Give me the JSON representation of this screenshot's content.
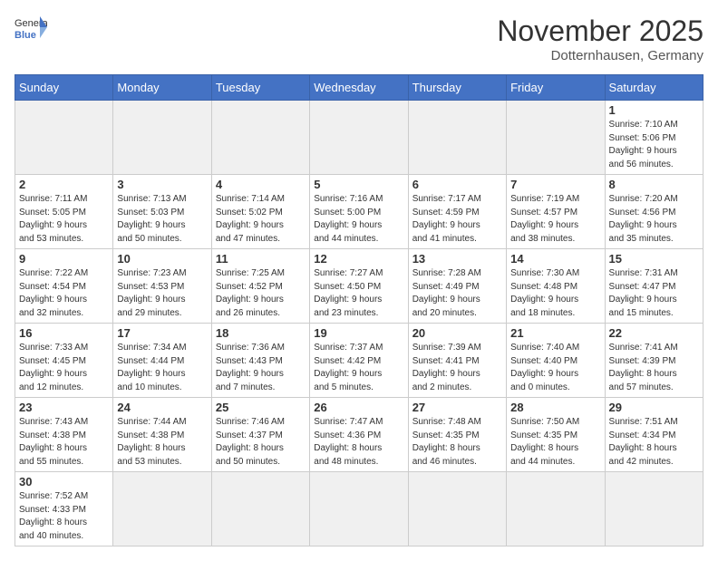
{
  "logo": {
    "text_general": "General",
    "text_blue": "Blue"
  },
  "title": "November 2025",
  "location": "Dotternhausen, Germany",
  "days_of_week": [
    "Sunday",
    "Monday",
    "Tuesday",
    "Wednesday",
    "Thursday",
    "Friday",
    "Saturday"
  ],
  "weeks": [
    [
      {
        "day": "",
        "info": ""
      },
      {
        "day": "",
        "info": ""
      },
      {
        "day": "",
        "info": ""
      },
      {
        "day": "",
        "info": ""
      },
      {
        "day": "",
        "info": ""
      },
      {
        "day": "",
        "info": ""
      },
      {
        "day": "1",
        "info": "Sunrise: 7:10 AM\nSunset: 5:06 PM\nDaylight: 9 hours\nand 56 minutes."
      }
    ],
    [
      {
        "day": "2",
        "info": "Sunrise: 7:11 AM\nSunset: 5:05 PM\nDaylight: 9 hours\nand 53 minutes."
      },
      {
        "day": "3",
        "info": "Sunrise: 7:13 AM\nSunset: 5:03 PM\nDaylight: 9 hours\nand 50 minutes."
      },
      {
        "day": "4",
        "info": "Sunrise: 7:14 AM\nSunset: 5:02 PM\nDaylight: 9 hours\nand 47 minutes."
      },
      {
        "day": "5",
        "info": "Sunrise: 7:16 AM\nSunset: 5:00 PM\nDaylight: 9 hours\nand 44 minutes."
      },
      {
        "day": "6",
        "info": "Sunrise: 7:17 AM\nSunset: 4:59 PM\nDaylight: 9 hours\nand 41 minutes."
      },
      {
        "day": "7",
        "info": "Sunrise: 7:19 AM\nSunset: 4:57 PM\nDaylight: 9 hours\nand 38 minutes."
      },
      {
        "day": "8",
        "info": "Sunrise: 7:20 AM\nSunset: 4:56 PM\nDaylight: 9 hours\nand 35 minutes."
      }
    ],
    [
      {
        "day": "9",
        "info": "Sunrise: 7:22 AM\nSunset: 4:54 PM\nDaylight: 9 hours\nand 32 minutes."
      },
      {
        "day": "10",
        "info": "Sunrise: 7:23 AM\nSunset: 4:53 PM\nDaylight: 9 hours\nand 29 minutes."
      },
      {
        "day": "11",
        "info": "Sunrise: 7:25 AM\nSunset: 4:52 PM\nDaylight: 9 hours\nand 26 minutes."
      },
      {
        "day": "12",
        "info": "Sunrise: 7:27 AM\nSunset: 4:50 PM\nDaylight: 9 hours\nand 23 minutes."
      },
      {
        "day": "13",
        "info": "Sunrise: 7:28 AM\nSunset: 4:49 PM\nDaylight: 9 hours\nand 20 minutes."
      },
      {
        "day": "14",
        "info": "Sunrise: 7:30 AM\nSunset: 4:48 PM\nDaylight: 9 hours\nand 18 minutes."
      },
      {
        "day": "15",
        "info": "Sunrise: 7:31 AM\nSunset: 4:47 PM\nDaylight: 9 hours\nand 15 minutes."
      }
    ],
    [
      {
        "day": "16",
        "info": "Sunrise: 7:33 AM\nSunset: 4:45 PM\nDaylight: 9 hours\nand 12 minutes."
      },
      {
        "day": "17",
        "info": "Sunrise: 7:34 AM\nSunset: 4:44 PM\nDaylight: 9 hours\nand 10 minutes."
      },
      {
        "day": "18",
        "info": "Sunrise: 7:36 AM\nSunset: 4:43 PM\nDaylight: 9 hours\nand 7 minutes."
      },
      {
        "day": "19",
        "info": "Sunrise: 7:37 AM\nSunset: 4:42 PM\nDaylight: 9 hours\nand 5 minutes."
      },
      {
        "day": "20",
        "info": "Sunrise: 7:39 AM\nSunset: 4:41 PM\nDaylight: 9 hours\nand 2 minutes."
      },
      {
        "day": "21",
        "info": "Sunrise: 7:40 AM\nSunset: 4:40 PM\nDaylight: 9 hours\nand 0 minutes."
      },
      {
        "day": "22",
        "info": "Sunrise: 7:41 AM\nSunset: 4:39 PM\nDaylight: 8 hours\nand 57 minutes."
      }
    ],
    [
      {
        "day": "23",
        "info": "Sunrise: 7:43 AM\nSunset: 4:38 PM\nDaylight: 8 hours\nand 55 minutes."
      },
      {
        "day": "24",
        "info": "Sunrise: 7:44 AM\nSunset: 4:38 PM\nDaylight: 8 hours\nand 53 minutes."
      },
      {
        "day": "25",
        "info": "Sunrise: 7:46 AM\nSunset: 4:37 PM\nDaylight: 8 hours\nand 50 minutes."
      },
      {
        "day": "26",
        "info": "Sunrise: 7:47 AM\nSunset: 4:36 PM\nDaylight: 8 hours\nand 48 minutes."
      },
      {
        "day": "27",
        "info": "Sunrise: 7:48 AM\nSunset: 4:35 PM\nDaylight: 8 hours\nand 46 minutes."
      },
      {
        "day": "28",
        "info": "Sunrise: 7:50 AM\nSunset: 4:35 PM\nDaylight: 8 hours\nand 44 minutes."
      },
      {
        "day": "29",
        "info": "Sunrise: 7:51 AM\nSunset: 4:34 PM\nDaylight: 8 hours\nand 42 minutes."
      }
    ],
    [
      {
        "day": "30",
        "info": "Sunrise: 7:52 AM\nSunset: 4:33 PM\nDaylight: 8 hours\nand 40 minutes."
      },
      {
        "day": "",
        "info": ""
      },
      {
        "day": "",
        "info": ""
      },
      {
        "day": "",
        "info": ""
      },
      {
        "day": "",
        "info": ""
      },
      {
        "day": "",
        "info": ""
      },
      {
        "day": "",
        "info": ""
      }
    ]
  ]
}
